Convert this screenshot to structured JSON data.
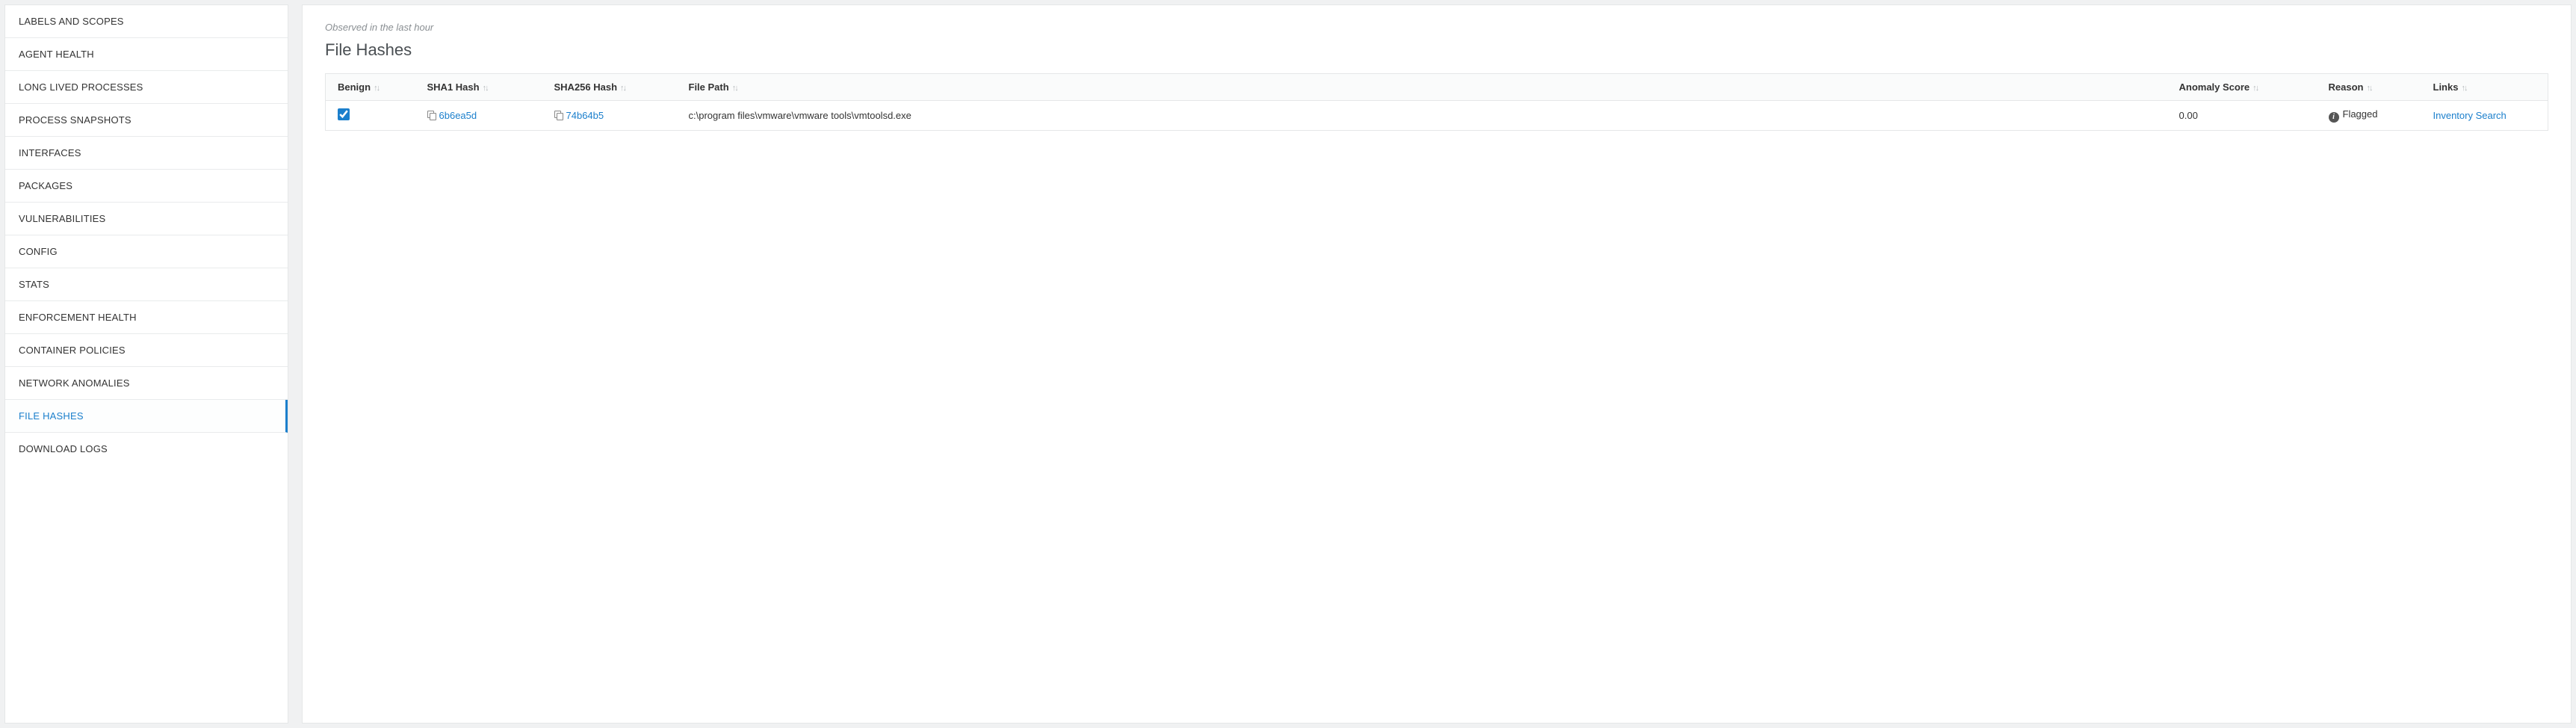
{
  "sidebar": {
    "items": [
      {
        "label": "LABELS AND SCOPES",
        "id": "labels-and-scopes",
        "active": false
      },
      {
        "label": "AGENT HEALTH",
        "id": "agent-health",
        "active": false
      },
      {
        "label": "LONG LIVED PROCESSES",
        "id": "long-lived-processes",
        "active": false
      },
      {
        "label": "PROCESS SNAPSHOTS",
        "id": "process-snapshots",
        "active": false
      },
      {
        "label": "INTERFACES",
        "id": "interfaces",
        "active": false
      },
      {
        "label": "PACKAGES",
        "id": "packages",
        "active": false
      },
      {
        "label": "VULNERABILITIES",
        "id": "vulnerabilities",
        "active": false
      },
      {
        "label": "CONFIG",
        "id": "config",
        "active": false
      },
      {
        "label": "STATS",
        "id": "stats",
        "active": false
      },
      {
        "label": "ENFORCEMENT HEALTH",
        "id": "enforcement-health",
        "active": false
      },
      {
        "label": "CONTAINER POLICIES",
        "id": "container-policies",
        "active": false
      },
      {
        "label": "NETWORK ANOMALIES",
        "id": "network-anomalies",
        "active": false
      },
      {
        "label": "FILE HASHES",
        "id": "file-hashes",
        "active": true
      },
      {
        "label": "DOWNLOAD LOGS",
        "id": "download-logs",
        "active": false
      }
    ]
  },
  "main": {
    "observed_text": "Observed in the last hour",
    "title": "File Hashes",
    "columns": {
      "benign": "Benign",
      "sha1": "SHA1 Hash",
      "sha256": "SHA256 Hash",
      "path": "File Path",
      "score": "Anomaly Score",
      "reason": "Reason",
      "links": "Links"
    },
    "rows": [
      {
        "benign": true,
        "sha1": "6b6ea5d",
        "sha256": "74b64b5",
        "path": "c:\\program files\\vmware\\vmware tools\\vmtoolsd.exe",
        "score": "0.00",
        "reason": "Flagged",
        "link_label": "Inventory Search"
      }
    ]
  }
}
